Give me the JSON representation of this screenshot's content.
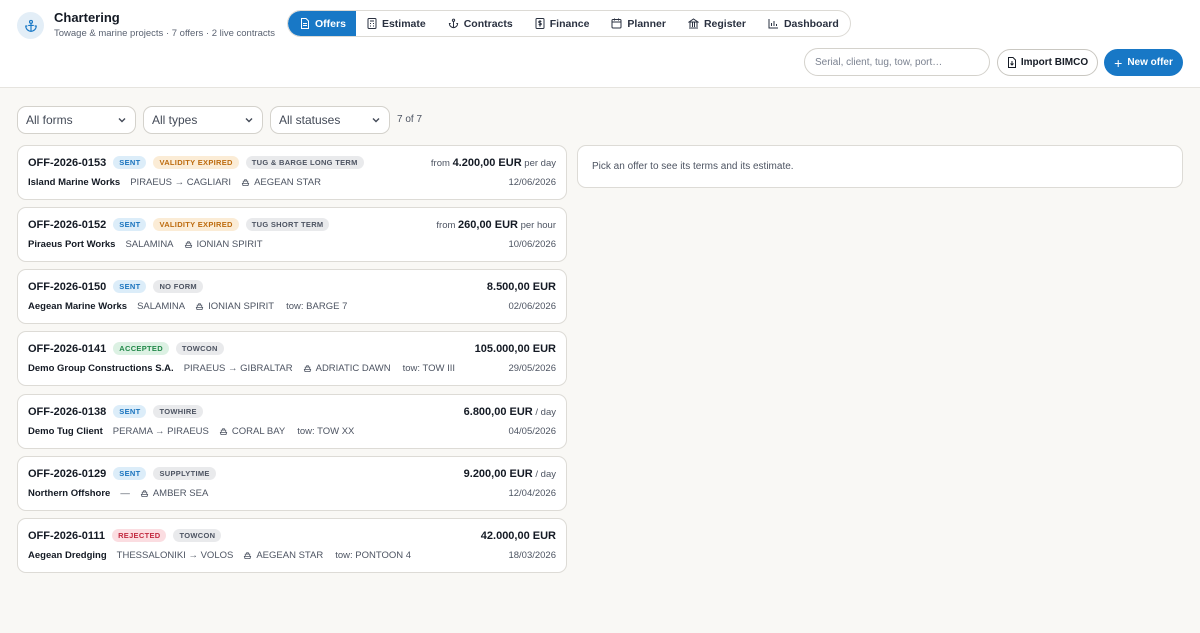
{
  "app": {
    "title": "Chartering",
    "subtitle": "Towage & marine projects · 7 offers · 2 live contracts"
  },
  "nav": {
    "tabs": [
      {
        "label": "Offers",
        "icon": "document-icon",
        "active": true
      },
      {
        "label": "Estimate",
        "icon": "calculator-icon"
      },
      {
        "label": "Contracts",
        "icon": "anchor-icon"
      },
      {
        "label": "Finance",
        "icon": "dollar-file-icon"
      },
      {
        "label": "Planner",
        "icon": "calendar-icon"
      },
      {
        "label": "Register",
        "icon": "bank-icon"
      },
      {
        "label": "Dashboard",
        "icon": "bar-chart-icon"
      }
    ]
  },
  "toolbar": {
    "search_placeholder": "Serial, client, tug, tow, port…",
    "import_label": "Import BIMCO",
    "new_label": "New offer"
  },
  "filters": {
    "forms": "All forms",
    "types": "All types",
    "statuses": "All statuses",
    "count": "7 of 7"
  },
  "offers": [
    {
      "serial": "OFF-2026-0153",
      "status": "SENT",
      "status_kind": "sent",
      "validity": "VALIDITY EXPIRED",
      "form": "TUG & BARGE LONG TERM",
      "client": "Island Marine Works",
      "route": "PIRAEUS → CAGLIARI",
      "vessel": "AEGEAN STAR",
      "tow": "",
      "price_pre": "from ",
      "price": "4.200,00 EUR",
      "price_post": " per day",
      "date": "12/06/2026"
    },
    {
      "serial": "OFF-2026-0152",
      "status": "SENT",
      "status_kind": "sent",
      "validity": "VALIDITY EXPIRED",
      "form": "TUG SHORT TERM",
      "client": "Piraeus Port Works",
      "route": "SALAMINA",
      "vessel": "IONIAN SPIRIT",
      "tow": "",
      "price_pre": "from ",
      "price": "260,00 EUR",
      "price_post": " per hour",
      "date": "10/06/2026"
    },
    {
      "serial": "OFF-2026-0150",
      "status": "SENT",
      "status_kind": "sent",
      "validity": "",
      "form": "NO FORM",
      "client": "Aegean Marine Works",
      "route": "SALAMINA",
      "vessel": "IONIAN SPIRIT",
      "tow": "tow: BARGE 7",
      "price_pre": "",
      "price": "8.500,00 EUR",
      "price_post": "",
      "date": "02/06/2026"
    },
    {
      "serial": "OFF-2026-0141",
      "status": "ACCEPTED",
      "status_kind": "accepted",
      "validity": "",
      "form": "TOWCON",
      "client": "Demo Group Constructions S.A.",
      "route": "PIRAEUS → GIBRALTAR",
      "vessel": "ADRIATIC DAWN",
      "tow": "tow: TOW III",
      "price_pre": "",
      "price": "105.000,00 EUR",
      "price_post": "",
      "date": "29/05/2026"
    },
    {
      "serial": "OFF-2026-0138",
      "status": "SENT",
      "status_kind": "sent",
      "validity": "",
      "form": "TOWHIRE",
      "client": "Demo Tug Client",
      "route": "PERAMA → PIRAEUS",
      "vessel": "CORAL BAY",
      "tow": "tow: TOW XX",
      "price_pre": "",
      "price": "6.800,00 EUR",
      "price_post": " / day",
      "date": "04/05/2026"
    },
    {
      "serial": "OFF-2026-0129",
      "status": "SENT",
      "status_kind": "sent",
      "validity": "",
      "form": "SUPPLYTIME",
      "client": "Northern Offshore",
      "route": "—",
      "vessel": "AMBER SEA",
      "tow": "",
      "price_pre": "",
      "price": "9.200,00 EUR",
      "price_post": " / day",
      "date": "12/04/2026"
    },
    {
      "serial": "OFF-2026-0111",
      "status": "REJECTED",
      "status_kind": "rejected",
      "validity": "",
      "form": "TOWCON",
      "client": "Aegean Dredging",
      "route": "THESSALONIKI → VOLOS",
      "vessel": "AEGEAN STAR",
      "tow": "tow: PONTOON 4",
      "price_pre": "",
      "price": "42.000,00 EUR",
      "price_post": "",
      "date": "18/03/2026"
    }
  ],
  "detail": {
    "empty_text": "Pick an offer to see its terms and its estimate."
  },
  "colors": {
    "accent": "#1878c6",
    "background": "#f9f8f5"
  }
}
